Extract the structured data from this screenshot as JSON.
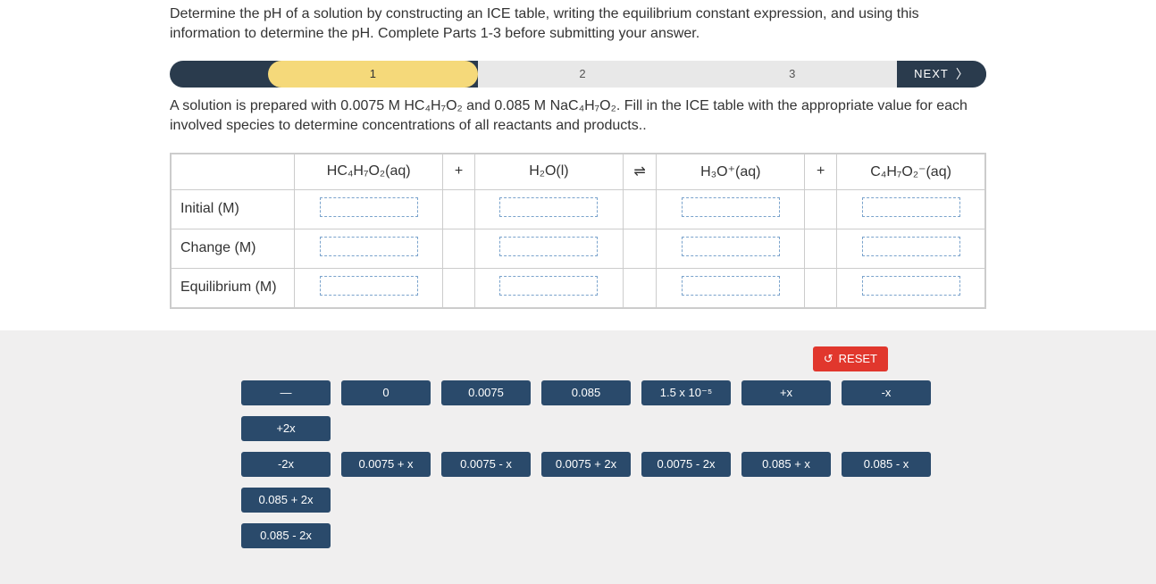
{
  "instructions": "Determine the pH of a solution by constructing an ICE table, writing the equilibrium constant expression, and using this information to determine the pH. Complete Parts 1-3 before submitting your answer.",
  "progress": {
    "step1": "1",
    "step2": "2",
    "step3": "3",
    "next": "NEXT"
  },
  "sub_instructions": "A solution is prepared with 0.0075 M HC₄H₇O₂ and 0.085 M NaC₄H₇O₂. Fill in the ICE table with the appropriate value for each involved species to determine concentrations of all reactants and products..",
  "table": {
    "species": {
      "s1": "HC₄H₇O₂(aq)",
      "s2": "H₂O(l)",
      "s3": "H₃O⁺(aq)",
      "s4": "C₄H₇O₂⁻(aq)"
    },
    "ops": {
      "plus": "+",
      "eq": "⇌"
    },
    "rows": {
      "initial": "Initial (M)",
      "change": "Change (M)",
      "equilibrium": "Equilibrium (M)"
    }
  },
  "reset": "RESET",
  "chips": {
    "r1": [
      "—",
      "0",
      "0.0075",
      "0.085",
      "1.5 x 10⁻⁵",
      "+x",
      "-x",
      "+2x"
    ],
    "r2": [
      "-2x",
      "0.0075 + x",
      "0.0075 - x",
      "0.0075 + 2x",
      "0.0075 - 2x",
      "0.085 + x",
      "0.085 - x",
      "0.085 + 2x"
    ],
    "r3": [
      "0.085 - 2x"
    ]
  }
}
